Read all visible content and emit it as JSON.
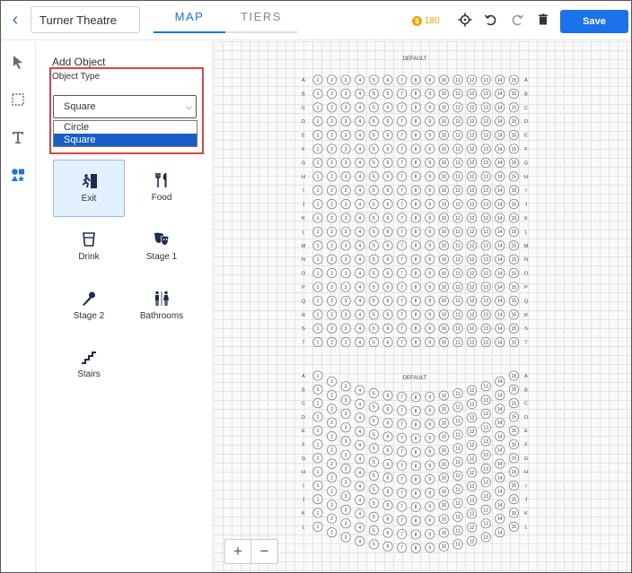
{
  "header": {
    "venue_name": "Turner Theatre",
    "tabs": [
      {
        "label": "MAP",
        "active": true
      },
      {
        "label": "TIERS",
        "active": false
      }
    ],
    "credits": "180",
    "save_label": "Save"
  },
  "panel": {
    "title": "Add Object",
    "field_label": "Object Type",
    "selected_value": "Square",
    "options": [
      "Circle",
      "Square"
    ],
    "objects": [
      {
        "label": "Exit",
        "icon": "exit-icon",
        "active": true
      },
      {
        "label": "Food",
        "icon": "food-icon",
        "active": false
      },
      {
        "label": "Drink",
        "icon": "drink-icon",
        "active": false
      },
      {
        "label": "Stage 1",
        "icon": "stage-mask-icon",
        "active": false
      },
      {
        "label": "Stage 2",
        "icon": "microphone-icon",
        "active": false
      },
      {
        "label": "Bathrooms",
        "icon": "restroom-icon",
        "active": false
      },
      {
        "label": "Stairs",
        "icon": "stairs-icon",
        "active": false
      }
    ]
  },
  "canvas": {
    "section1": {
      "title": "DEFAULT",
      "rows": [
        "A",
        "B",
        "C",
        "D",
        "E",
        "F",
        "G",
        "H",
        "I",
        "J",
        "K",
        "L",
        "M",
        "N",
        "O",
        "P",
        "Q",
        "R",
        "S",
        "T"
      ],
      "seats_per_row": 15
    },
    "section2": {
      "title": "DEFAULT",
      "rows": [
        "A",
        "B",
        "C",
        "D",
        "E",
        "F",
        "G",
        "H",
        "I",
        "J",
        "K",
        "L"
      ],
      "seats_per_row": 15
    }
  },
  "zoom": {
    "in_label": "+",
    "out_label": "−"
  },
  "colors": {
    "accent": "#1a73e8",
    "highlight": "#e0443e",
    "credits": "#f0a500"
  }
}
